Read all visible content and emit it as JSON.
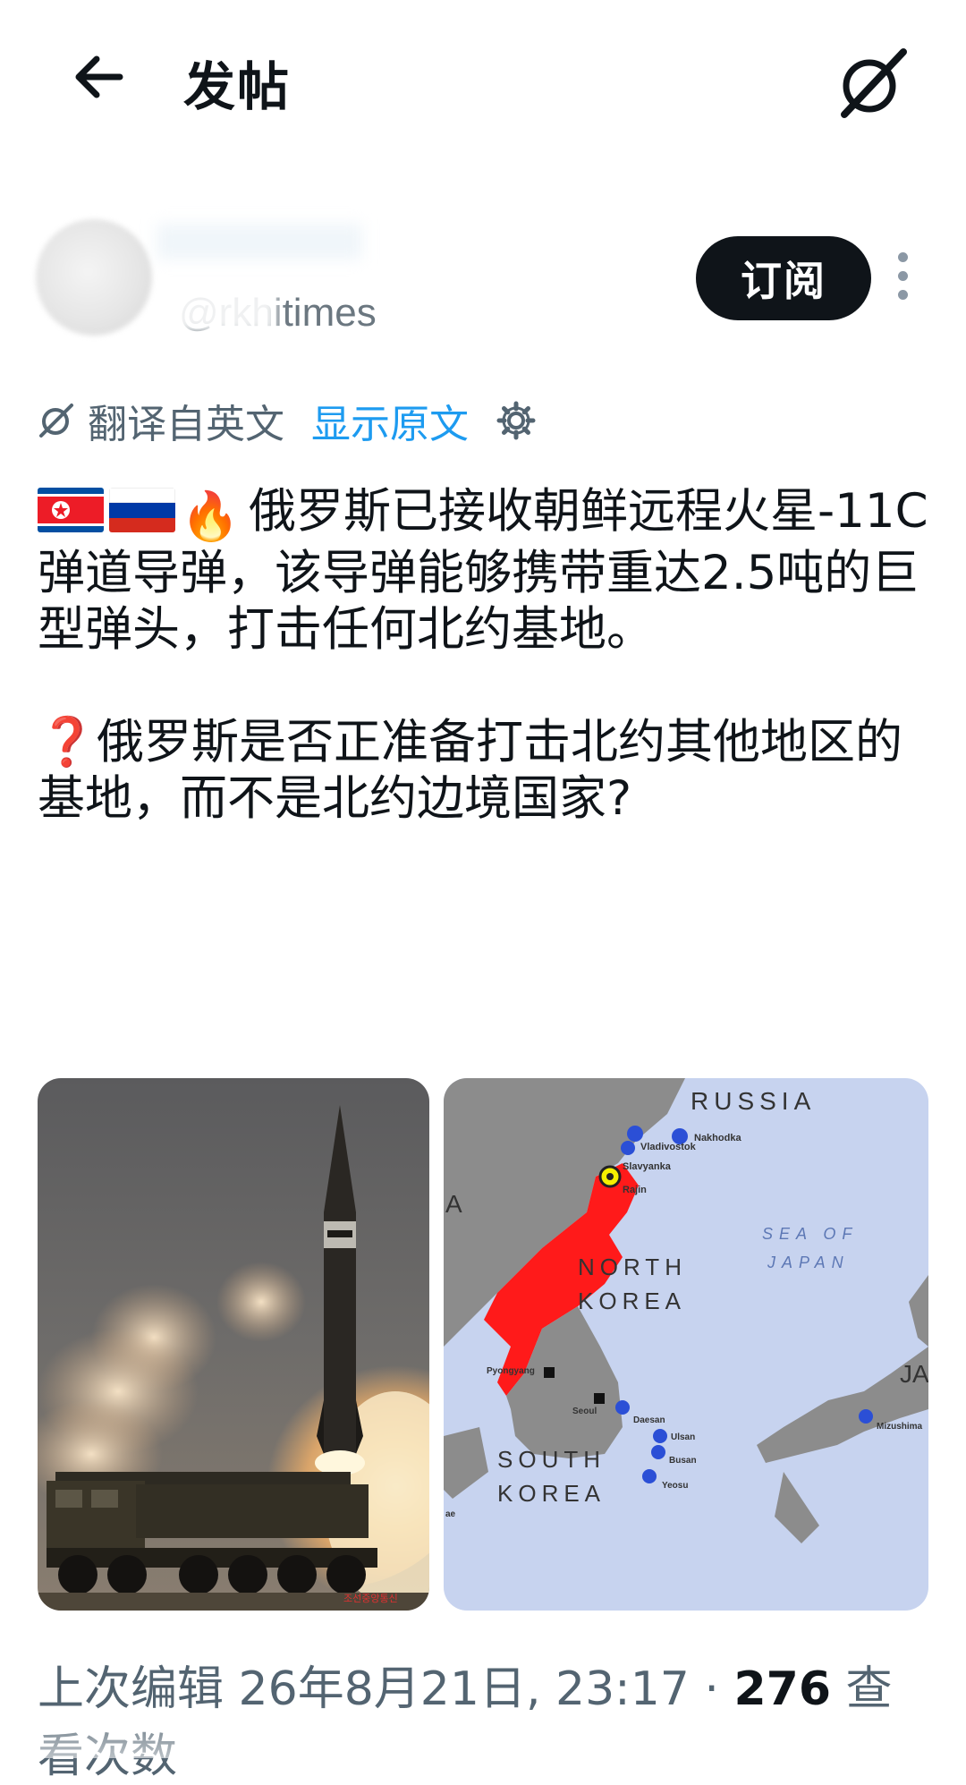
{
  "header": {
    "title": "发帖",
    "back_icon": "arrow-left-icon",
    "grok_icon": "grok-icon"
  },
  "author": {
    "handle": "@rkhitimes",
    "subscribe_label": "订阅",
    "more_icon": "more-vertical-icon"
  },
  "translation": {
    "label": "翻译自英文",
    "show_original": "显示原文",
    "settings_icon": "gear-icon"
  },
  "post": {
    "line1_prefix_flags": [
      "north-korea-flag",
      "russia-flag"
    ],
    "fire_emoji": "🔥",
    "paragraph1_text": "俄罗斯已接收朝鲜远程火星-11C弹道导弹，该导弹能够携带重达2.5吨的巨型弹头，打击任何北约基地。",
    "question_emoji": "❓",
    "paragraph2_text": "俄罗斯是否正准备打击北约其他地区的基地，而不是北约边境国家?"
  },
  "media": {
    "image1": {
      "description_icon": "missile-launch-image",
      "watermark": "조선중앙통신"
    },
    "image2": {
      "labels": {
        "russia": "RUSSIA",
        "nakhodka": "Nakhodka",
        "vladivostok": "Vladivostok",
        "slavyanka": "Slavyanka",
        "rajin": "Rajin",
        "sea_of_japan_1": "SEA OF",
        "sea_of_japan_2": "JAPAN",
        "north_korea_1": "NORTH",
        "north_korea_2": "KOREA",
        "pyongyang": "Pyongyang",
        "seoul": "Seoul",
        "daesan": "Daesan",
        "south_korea_1": "SOUTH",
        "south_korea_2": "KOREA",
        "ulsan": "Ulsan",
        "busan": "Busan",
        "yeosu": "Yeosu",
        "mizushima": "Mizushima",
        "edge_a": "A",
        "edge_ja": "JA",
        "edge_ae": "ae"
      },
      "colors": {
        "sea": "#c7d3ef",
        "land": "#8c8c8c",
        "north_korea": "#ff1a1a",
        "port": "#2b4fd6"
      }
    }
  },
  "meta": {
    "edited_prefix": "上次编辑 26年8月21日, 23:17 · ",
    "views_count": "276",
    "views_suffix": " 查",
    "views_line2": "看次数"
  }
}
